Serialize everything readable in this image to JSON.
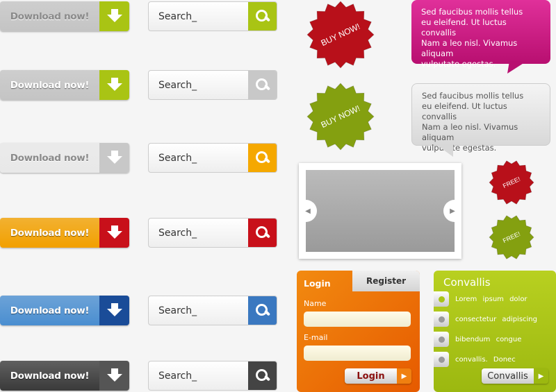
{
  "download_buttons": [
    {
      "label": "Download now!",
      "variant": "gray-text",
      "colors": {
        "bg": "#c4c4c4",
        "text": "#8a8a8a",
        "arrow": "#a9c414"
      }
    },
    {
      "label": "Download now!",
      "variant": "white-text",
      "colors": {
        "bg": "#c4c4c4",
        "text": "#ffffff",
        "arrow": "#a9c414"
      }
    },
    {
      "label": "Download now!",
      "variant": "light",
      "colors": {
        "bg": "#e8e8e8",
        "text": "#8a8a8a",
        "arrow": "#c8c8c8"
      }
    },
    {
      "label": "Download now!",
      "variant": "orange",
      "colors": {
        "bg": "#f2a000",
        "text": "#ffffff",
        "arrow": "#c8101a"
      }
    },
    {
      "label": "Download now!",
      "variant": "blue",
      "colors": {
        "bg": "#4a8ed0",
        "text": "#ffffff",
        "arrow": "#1a4c98"
      }
    },
    {
      "label": "Download now!",
      "variant": "dark",
      "colors": {
        "bg": "#3a3a3a",
        "text": "#ffffff",
        "arrow": "#555555"
      }
    }
  ],
  "search_boxes": [
    {
      "value": "Search_",
      "button_color": "#a9c414",
      "icon": "magnifier-icon"
    },
    {
      "value": "Search_",
      "button_color": "#c8c8c8",
      "icon": "magnifier-icon"
    },
    {
      "value": "Search_",
      "button_color": "#f5a800",
      "icon": "magnifier-icon"
    },
    {
      "value": "Search_",
      "button_color": "#c8101a",
      "icon": "magnifier-icon"
    },
    {
      "value": "Search_",
      "button_color": "#3a78c0",
      "icon": "magnifier-icon"
    },
    {
      "value": "Search_",
      "button_color": "#444444",
      "icon": "magnifier-icon"
    }
  ],
  "badges": [
    {
      "label": "BUY NOW!",
      "color": "#b8101a"
    },
    {
      "label": "BUY NOW!",
      "color": "#84a010"
    },
    {
      "label": "FREE!",
      "color": "#b8101a"
    },
    {
      "label": "FREE!",
      "color": "#84a010"
    }
  ],
  "bubbles": [
    {
      "text": "Sed faucibus mollis tellus\neu eleifend. Ut luctus convallis\nNam a leo nisl. Vivamus aliquam\nvulputate egestas.",
      "color": "#c8157e"
    },
    {
      "text": "Sed faucibus mollis tellus\neu eleifend. Ut luctus convallis\nNam a leo nisl. Vivamus aliquam\nvulputate egestas.",
      "color": "#e6e6e6"
    }
  ],
  "slider": {
    "prev_icon": "chevron-left-icon",
    "next_icon": "chevron-right-icon"
  },
  "login_panel": {
    "tabs": [
      "Login",
      "Register"
    ],
    "active_tab": "Login",
    "name_label": "Name",
    "email_label": "E-mail",
    "name_value": "",
    "email_value": "",
    "submit_label": "Login",
    "color": "#f07000"
  },
  "options_panel": {
    "title": "Convallis",
    "options": [
      "Lorem ipsum dolor",
      "consectetur adipiscing",
      "bibendum congue",
      "convallis. Donec"
    ],
    "selected": 0,
    "button_label": "Convallis",
    "color": "#a8c418"
  }
}
